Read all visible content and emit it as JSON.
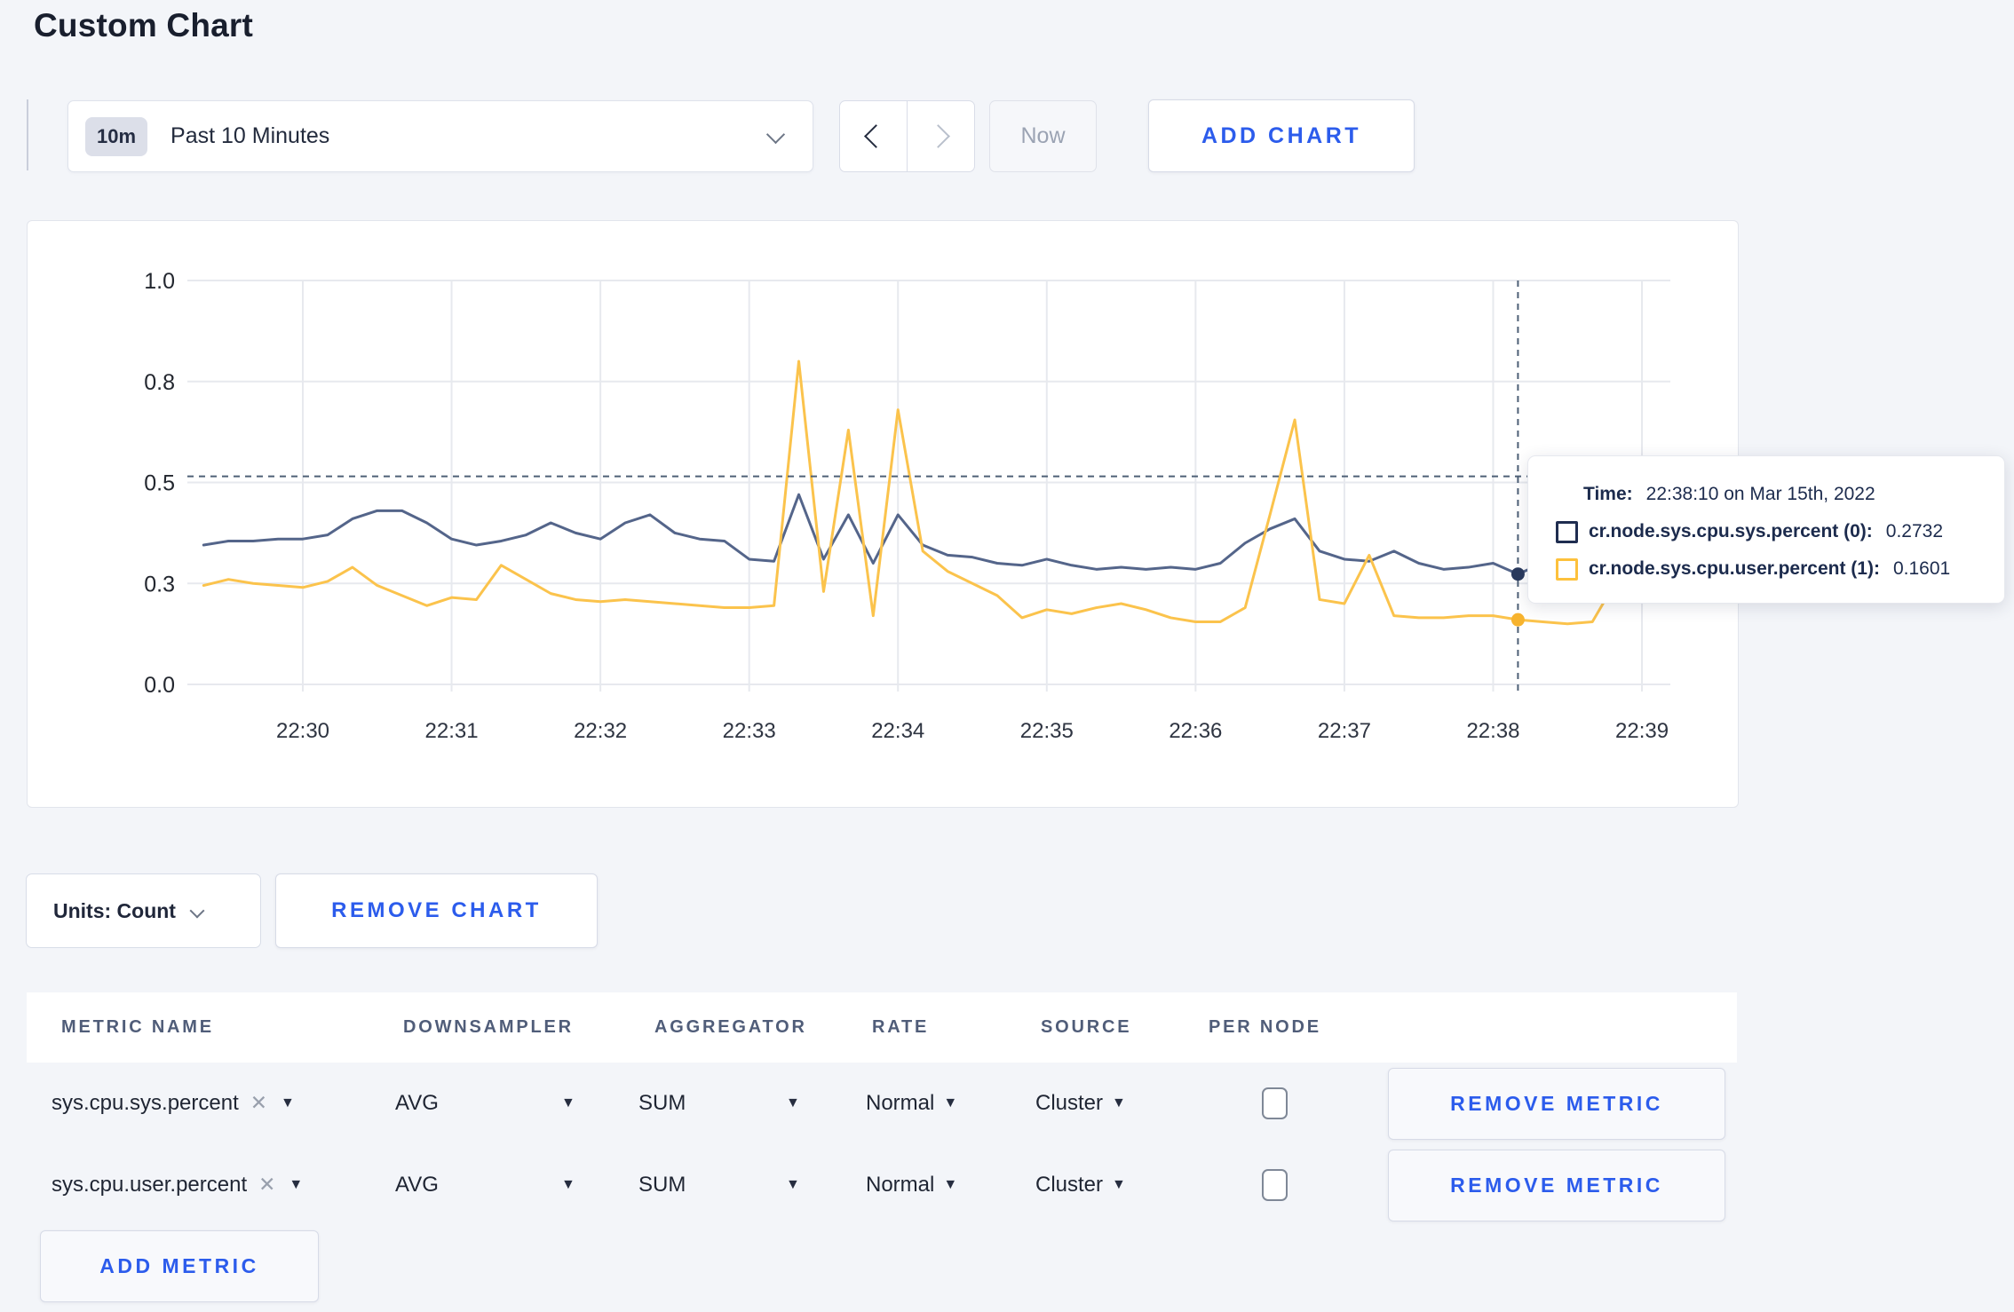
{
  "page": {
    "title": "Custom Chart",
    "background": "#f3f5f9",
    "accent_blue": "#2c5cec"
  },
  "toolbar": {
    "range_badge": "10m",
    "range_label": "Past 10 Minutes",
    "now_label": "Now",
    "add_chart_label": "ADD CHART"
  },
  "chart_data": {
    "type": "line",
    "title": "",
    "xlabel": "",
    "ylabel": "",
    "ylim": [
      0,
      1
    ],
    "grid": true,
    "legend_position": "tooltip",
    "x_tick_labels": [
      "22:30",
      "22:31",
      "22:32",
      "22:33",
      "22:34",
      "22:35",
      "22:36",
      "22:37",
      "22:38",
      "22:39"
    ],
    "y_tick_labels": [
      "1.0",
      "0.8",
      "0.5",
      "0.3",
      "0.0"
    ],
    "y_tick_positions": [
      1,
      0.75,
      0.5,
      0.25,
      0
    ],
    "x_start_time": "22:29:20",
    "x_step_seconds": 10,
    "series": [
      {
        "name": "cr.node.sys.cpu.sys.percent",
        "color": "#54658a",
        "dot_color": "#2a3a5e",
        "values": [
          0.345,
          0.355,
          0.355,
          0.36,
          0.36,
          0.37,
          0.41,
          0.43,
          0.43,
          0.4,
          0.36,
          0.345,
          0.355,
          0.37,
          0.4,
          0.375,
          0.36,
          0.4,
          0.42,
          0.375,
          0.36,
          0.355,
          0.31,
          0.305,
          0.47,
          0.31,
          0.42,
          0.3,
          0.42,
          0.345,
          0.32,
          0.315,
          0.3,
          0.295,
          0.31,
          0.295,
          0.285,
          0.29,
          0.285,
          0.29,
          0.285,
          0.3,
          0.35,
          0.385,
          0.41,
          0.33,
          0.31,
          0.305,
          0.33,
          0.3,
          0.285,
          0.29,
          0.3,
          0.2732,
          0.3,
          0.32,
          0.31,
          0.3,
          0.3,
          0.31
        ]
      },
      {
        "name": "cr.node.sys.cpu.user.percent",
        "color": "#fbc34c",
        "dot_color": "#f7b32e",
        "values": [
          0.245,
          0.26,
          0.25,
          0.245,
          0.24,
          0.255,
          0.29,
          0.245,
          0.22,
          0.195,
          0.215,
          0.21,
          0.295,
          0.26,
          0.225,
          0.21,
          0.205,
          0.21,
          0.205,
          0.2,
          0.195,
          0.19,
          0.19,
          0.195,
          0.8,
          0.23,
          0.63,
          0.17,
          0.68,
          0.33,
          0.28,
          0.25,
          0.22,
          0.165,
          0.185,
          0.175,
          0.19,
          0.2,
          0.185,
          0.165,
          0.155,
          0.155,
          0.19,
          0.42,
          0.655,
          0.21,
          0.2,
          0.32,
          0.17,
          0.165,
          0.165,
          0.17,
          0.17,
          0.1601,
          0.155,
          0.15,
          0.155,
          0.26,
          0.29,
          0.245
        ]
      }
    ],
    "crosshair": {
      "x_index": 53,
      "time": "22:38:10",
      "hline_value": 0.515,
      "sys_value": 0.2732,
      "user_value": 0.1601
    }
  },
  "tooltip": {
    "time_label": "Time:",
    "time_value": "22:38:10 on Mar 15th, 2022",
    "rows": [
      {
        "label": "cr.node.sys.cpu.sys.percent (0):",
        "value": "0.2732",
        "color": "#1f2d50"
      },
      {
        "label": "cr.node.sys.cpu.user.percent (1):",
        "value": "0.1601",
        "color": "#fdc13c"
      }
    ]
  },
  "chart_controls": {
    "units_label": "Units: Count",
    "remove_chart_label": "REMOVE CHART"
  },
  "metrics_table": {
    "headers": [
      "METRIC NAME",
      "DOWNSAMPLER",
      "AGGREGATOR",
      "RATE",
      "SOURCE",
      "PER NODE"
    ],
    "rows": [
      {
        "metric": "sys.cpu.sys.percent",
        "remove_icon": "✕",
        "downsampler": "AVG",
        "aggregator": "SUM",
        "rate": "Normal",
        "source": "Cluster",
        "per_node_checked": false,
        "remove_label": "REMOVE METRIC"
      },
      {
        "metric": "sys.cpu.user.percent",
        "remove_icon": "✕",
        "downsampler": "AVG",
        "aggregator": "SUM",
        "rate": "Normal",
        "source": "Cluster",
        "per_node_checked": false,
        "remove_label": "REMOVE METRIC"
      }
    ],
    "add_metric_label": "ADD METRIC"
  }
}
